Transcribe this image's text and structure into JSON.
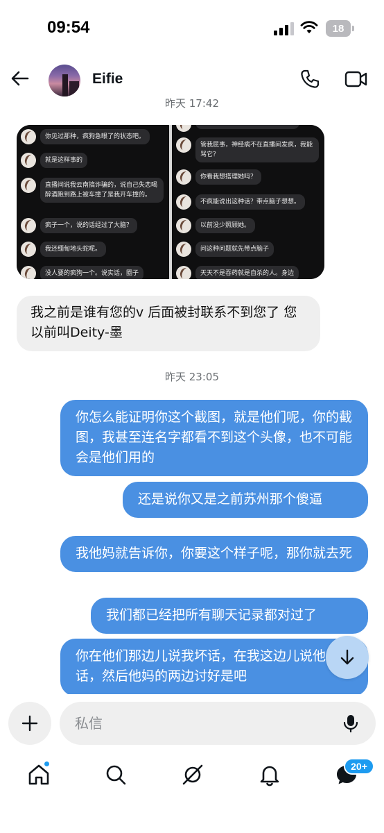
{
  "status_bar": {
    "time": "09:54",
    "battery": "18"
  },
  "header": {
    "contact_name": "Eifie"
  },
  "chat": {
    "timestamp_top": "昨天 17:42",
    "screenshot_left": [
      "你见过那种，疯狗急眼了的状态吧。",
      "就是这样事的",
      "直播间说我云南搞诈骗的，说自己失恋喝醉酒跑到路上被车撞了是我开车撞的。",
      "疯子一个，说的话经过了大脑？",
      "我还缅甸地头蛇呢。",
      "没人要的疯狗一个。说实话，圈子"
    ],
    "screenshot_right": [
      "",
      "管我屁事，神经病不在直播间发疯，我能骂它？",
      "你看我想搭理她吗？",
      "不疯能说出这种话？带点脑子想想。",
      "以前没少照顾她。",
      "问这种问题就先带点脑子",
      "天天不是吞药就是自杀的人。身边"
    ],
    "incoming_message": "我之前是谁有您的v 后面被封联系不到您了 您以前叫Deity-墨",
    "timestamp_mid": "昨天 23:05",
    "outgoing_messages": [
      "你怎么能证明你这个截图，就是他们呢，你的截图，我甚至连名字都看不到这个头像，也不可能会是他们用的",
      "还是说你又是之前苏州那个傻逼",
      "我他妈就告诉你，你要这个样子呢，那你就去死",
      "我们都已经把所有聊天记录都对过了",
      "你在他们那边儿说我坏话，在我这边儿说他们坏话，然后他妈的两边讨好是吧"
    ]
  },
  "composer": {
    "placeholder": "私信"
  },
  "nav": {
    "messages_badge": "20+"
  },
  "colors": {
    "outgoing_bubble": "#4a90e2",
    "incoming_bubble": "#efefef",
    "accent": "#1d9bf0"
  },
  "icons": {
    "back": "arrow-left-icon",
    "call": "phone-icon",
    "video": "video-camera-icon",
    "add": "plus-icon",
    "mic": "microphone-icon",
    "scroll": "arrow-down-icon",
    "home": "home-icon",
    "search": "search-icon",
    "grok": "grok-icon",
    "notifications": "bell-icon",
    "messages": "message-bubble-icon"
  }
}
